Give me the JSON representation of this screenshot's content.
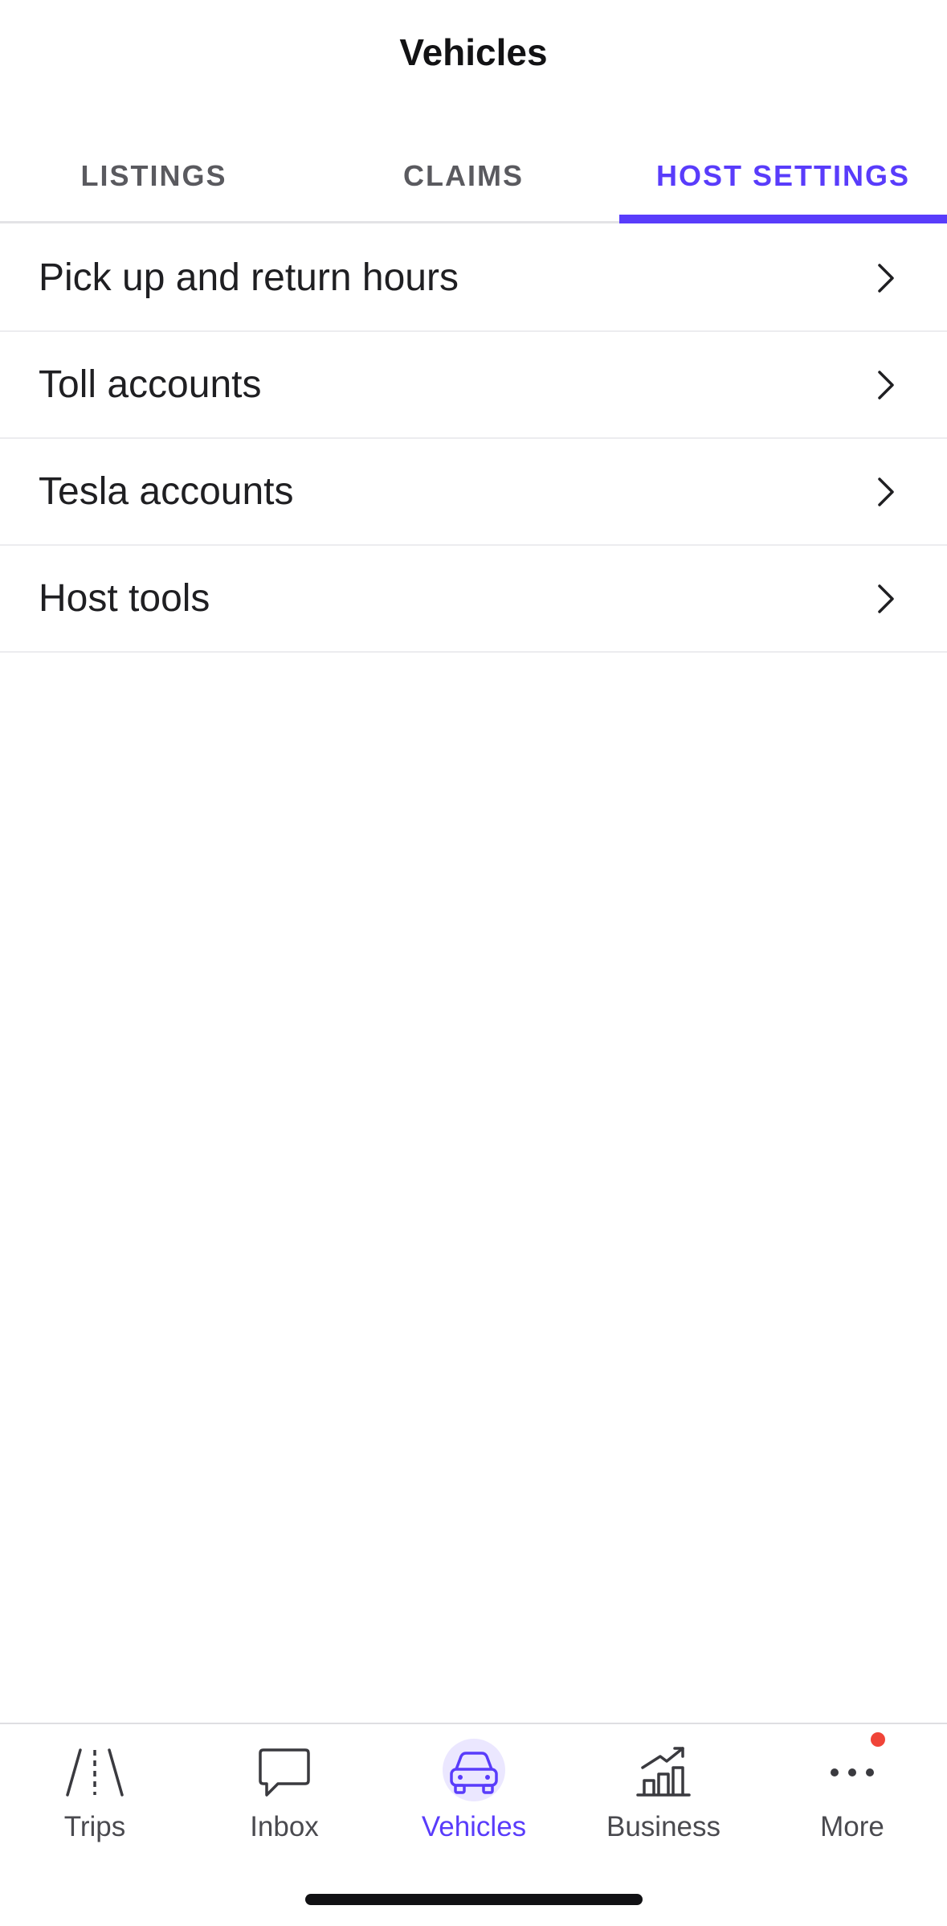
{
  "header": {
    "title": "Vehicles"
  },
  "tabs": [
    {
      "label": "LISTINGS",
      "active": false
    },
    {
      "label": "CLAIMS",
      "active": false
    },
    {
      "label": "HOST SETTINGS",
      "active": true
    }
  ],
  "settings_list": [
    {
      "label": "Pick up and return hours",
      "icon": "chevron-right-icon"
    },
    {
      "label": "Toll accounts",
      "icon": "chevron-right-icon"
    },
    {
      "label": "Tesla accounts",
      "icon": "chevron-right-icon"
    },
    {
      "label": "Host tools",
      "icon": "chevron-right-icon"
    }
  ],
  "bottom_nav": [
    {
      "label": "Trips",
      "icon": "road-icon",
      "active": false
    },
    {
      "label": "Inbox",
      "icon": "chat-bubble-icon",
      "active": false
    },
    {
      "label": "Vehicles",
      "icon": "car-icon",
      "active": true
    },
    {
      "label": "Business",
      "icon": "bar-chart-trend-icon",
      "active": false
    },
    {
      "label": "More",
      "icon": "more-dots-icon",
      "active": false,
      "has_notification": true
    }
  ],
  "colors": {
    "accent": "#593cfb",
    "text_primary": "#1f1f22",
    "tab_inactive": "#5a5a5f",
    "divider": "#ececef",
    "notification": "#f04438"
  }
}
